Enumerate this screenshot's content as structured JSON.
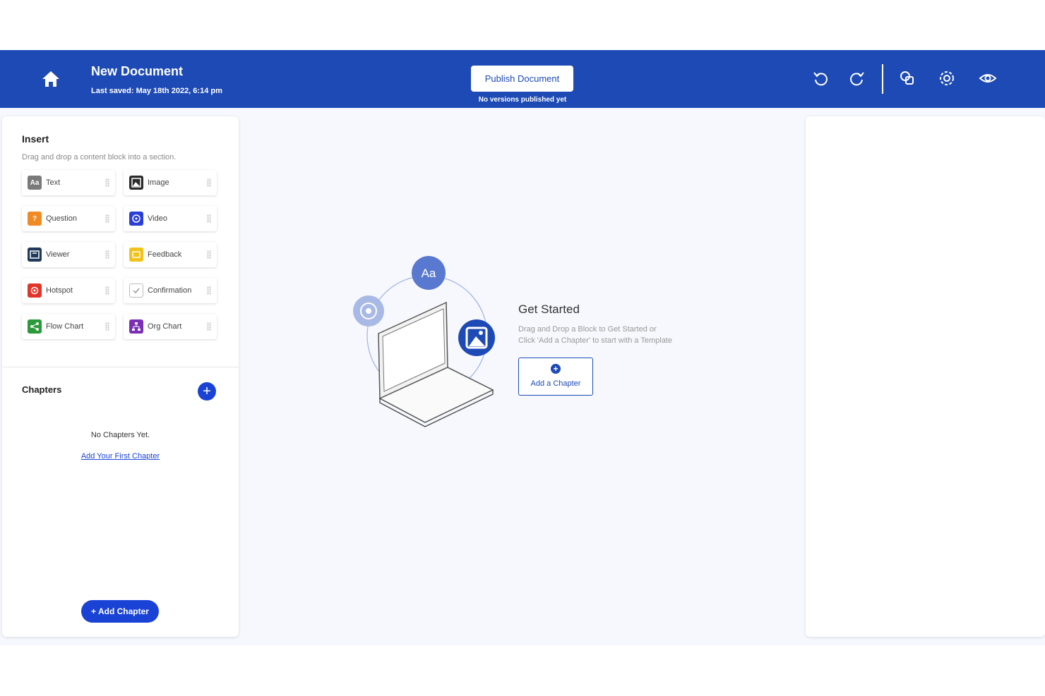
{
  "header": {
    "title": "New Document",
    "last_saved": "Last saved: May 18th 2022, 6:14 pm",
    "publish_label": "Publish Document",
    "publish_note": "No versions published yet",
    "icons": [
      "home-icon",
      "undo-icon",
      "redo-icon",
      "theme-icon",
      "settings-icon",
      "preview-icon"
    ]
  },
  "insert": {
    "title": "Insert",
    "subtitle": "Drag and drop a content block into a section.",
    "blocks": [
      {
        "label": "Text",
        "icon": "text-icon",
        "color": "#7a7a7a"
      },
      {
        "label": "Image",
        "icon": "image-icon",
        "color": "#2b2b2b"
      },
      {
        "label": "Question",
        "icon": "question-icon",
        "color": "#f08a24"
      },
      {
        "label": "Video",
        "icon": "video-icon",
        "color": "#2a3fd6"
      },
      {
        "label": "Viewer",
        "icon": "viewer-icon",
        "color": "#1f3a5a"
      },
      {
        "label": "Feedback",
        "icon": "feedback-icon",
        "color": "#f2c21b"
      },
      {
        "label": "Hotspot",
        "icon": "hotspot-icon",
        "color": "#e0352b"
      },
      {
        "label": "Confirmation",
        "icon": "confirmation-icon",
        "color": "#ffffff"
      },
      {
        "label": "Flow Chart",
        "icon": "flow-chart-icon",
        "color": "#2a9a3a"
      },
      {
        "label": "Org Chart",
        "icon": "org-chart-icon",
        "color": "#7b2fb6"
      }
    ]
  },
  "chapters": {
    "title": "Chapters",
    "empty_text": "No Chapters Yet.",
    "add_first_link": "Add Your First Chapter",
    "add_button": "+ Add Chapter"
  },
  "get_started": {
    "title": "Get Started",
    "line1": "Drag and Drop a Block to Get Started or",
    "line2": "Click 'Add a Chapter' to start with a Template",
    "button_label": "Add a Chapter",
    "bubble_text": "Aa"
  },
  "colors": {
    "primary": "#1d4ab4",
    "accent": "#1a43d6"
  }
}
